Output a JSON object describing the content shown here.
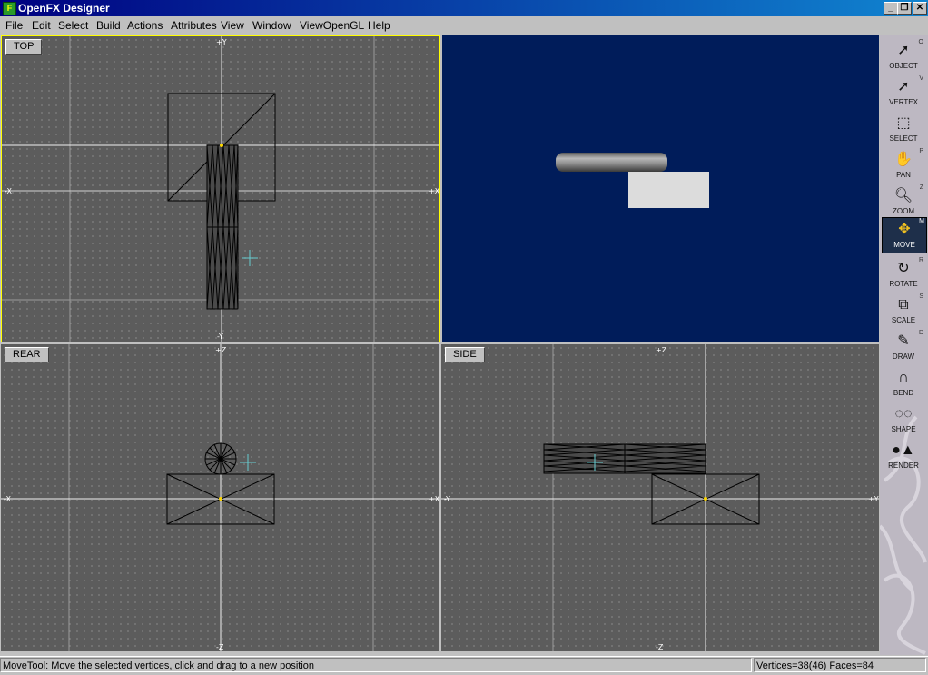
{
  "window": {
    "title": "OpenFX Designer",
    "app_icon": "openfx-icon",
    "min": "_",
    "restore": "❐",
    "close": "✕"
  },
  "menu": [
    "File",
    "Edit",
    "Select",
    "Build",
    "Actions",
    "Attributes",
    "View",
    "Window",
    "ViewOpenGL",
    "Help"
  ],
  "viewports": {
    "top": {
      "label": "TOP",
      "axes": {
        "top": "+Y",
        "bottom": "-Y",
        "left": "-X",
        "right": "+X"
      }
    },
    "rear": {
      "label": "REAR",
      "axes": {
        "top": "+Z",
        "bottom": "-Z",
        "left": "-X",
        "right": "+X"
      }
    },
    "side": {
      "label": "SIDE",
      "axes": {
        "top": "+Z",
        "bottom": "-Z",
        "left": "-Y",
        "right": "+Y"
      }
    }
  },
  "tools": [
    {
      "label": "OBJECT",
      "key": "O",
      "icon": "pointer-icon",
      "active": false
    },
    {
      "label": "VERTEX",
      "key": "V",
      "icon": "vertex-pointer-icon",
      "active": false
    },
    {
      "label": "SELECT",
      "key": "",
      "icon": "select-box-icon",
      "active": false
    },
    {
      "label": "PAN",
      "key": "P",
      "icon": "hand-icon",
      "active": false
    },
    {
      "label": "ZOOM",
      "key": "Z",
      "icon": "magnifier-icon",
      "active": false
    },
    {
      "label": "MOVE",
      "key": "M",
      "icon": "move-arrows-icon",
      "active": true
    },
    {
      "label": "ROTATE",
      "key": "R",
      "icon": "rotate-icon",
      "active": false
    },
    {
      "label": "SCALE",
      "key": "S",
      "icon": "scale-icon",
      "active": false
    },
    {
      "label": "DRAW",
      "key": "D",
      "icon": "pen-icon",
      "active": false
    },
    {
      "label": "BEND",
      "key": "",
      "icon": "magnet-icon",
      "active": false
    },
    {
      "label": "SHAPE",
      "key": "",
      "icon": "shapes-icon",
      "active": false
    },
    {
      "label": "RENDER",
      "key": "",
      "icon": "render-icon",
      "active": false
    }
  ],
  "status": {
    "message": "MoveTool: Move the selected vertices, click and drag to a new position",
    "info": "Vertices=38(46) Faces=84"
  },
  "colors": {
    "perspective_bg": "#001c5a",
    "active_border": "#ffff00",
    "grid_bg": "#5c5c5c"
  }
}
